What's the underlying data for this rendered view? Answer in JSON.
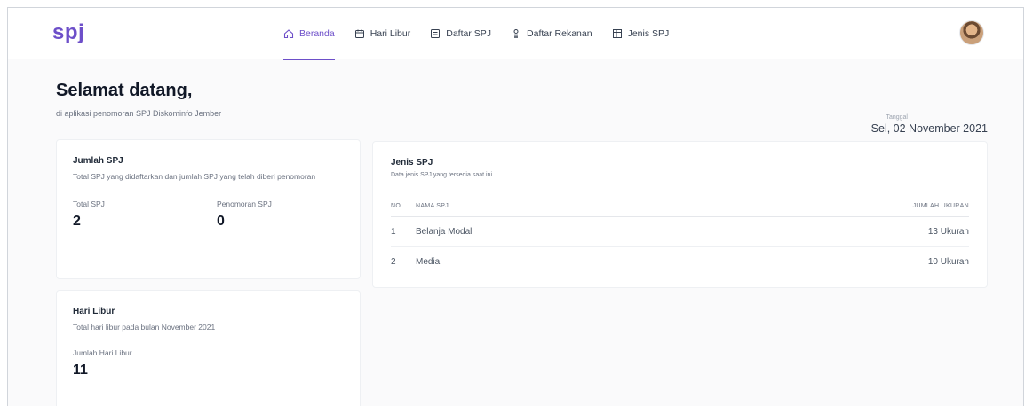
{
  "nav": {
    "brand": "spj",
    "items": [
      {
        "label": "Beranda",
        "icon": "home-icon",
        "active": true
      },
      {
        "label": "Hari Libur",
        "icon": "calendar-icon",
        "active": false
      },
      {
        "label": "Daftar SPJ",
        "icon": "list-icon",
        "active": false
      },
      {
        "label": "Daftar Rekanan",
        "icon": "user-icon",
        "active": false
      },
      {
        "label": "Jenis SPJ",
        "icon": "grid-icon",
        "active": false
      }
    ],
    "accent_color": "#6d4fc9"
  },
  "header": {
    "title": "Selamat datang,",
    "subtitle": "di aplikasi penomoran SPJ Diskominfo Jember",
    "date_label": "Tanggal",
    "date_value": "Sel, 02 November 2021"
  },
  "jumlah_spj": {
    "title": "Jumlah SPJ",
    "desc": "Total SPJ yang didaftarkan dan jumlah SPJ yang telah diberi penomoran",
    "total_label": "Total SPJ",
    "total_value": "2",
    "penomoran_label": "Penomoran SPJ",
    "penomoran_value": "0"
  },
  "hari_libur": {
    "title": "Hari Libur",
    "desc": "Total hari libur pada bulan November 2021",
    "count_label": "Jumlah Hari Libur",
    "count_value": "11"
  },
  "jenis_spj": {
    "title": "Jenis SPJ",
    "desc": "Data jenis SPJ yang tersedia saat ini",
    "headers": [
      "NO",
      "NAMA SPJ",
      "JUMLAH UKURAN"
    ],
    "rows": [
      {
        "no": "1",
        "name": "Belanja Modal",
        "count": "13 Ukuran"
      },
      {
        "no": "2",
        "name": "Media",
        "count": "10 Ukuran"
      }
    ]
  }
}
